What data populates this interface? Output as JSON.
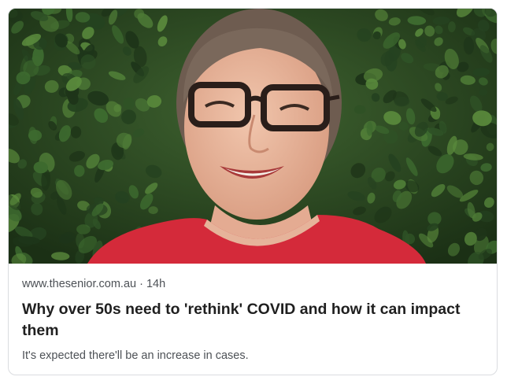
{
  "article": {
    "source": "www.thesenior.com.au",
    "separator": "·",
    "age": "14h",
    "title": "Why over 50s need to 'rethink' COVID and how it can impact them",
    "snippet": "It's expected there'll be an increase in cases."
  },
  "image": {
    "subject": "smiling woman with dark rimmed glasses in red top in front of green ivy hedge",
    "colors": {
      "foliage": "#2d4a23",
      "shirt": "#d42a3a",
      "skin": "#e9b9a0",
      "hair": "#6e5c50"
    }
  }
}
